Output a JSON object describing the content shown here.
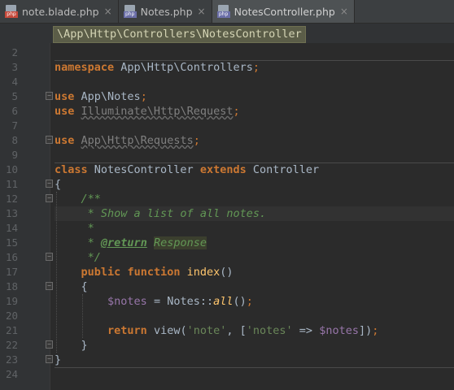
{
  "tabs": [
    {
      "name": "note.blade.php",
      "icon": "blade-file-icon",
      "icon_text": "php",
      "close": "×",
      "active": false
    },
    {
      "name": "Notes.php",
      "icon": "php-file-icon",
      "icon_text": "php",
      "close": "×",
      "active": false
    },
    {
      "name": "NotesController.php",
      "icon": "php-file-icon",
      "icon_text": "php",
      "close": "×",
      "active": true
    }
  ],
  "breadcrumb": "\\App\\Http\\Controllers\\NotesController",
  "editor": {
    "line_numbers": [
      "2",
      "3",
      "4",
      "5",
      "6",
      "7",
      "8",
      "9",
      "10",
      "11",
      "12",
      "13",
      "14",
      "15",
      "16",
      "17",
      "18",
      "19",
      "20",
      "21",
      "22",
      "23",
      "24"
    ],
    "code": {
      "l3_kw": "namespace",
      "l3_ns": " App\\Http\\Controllers",
      "semi": ";",
      "use": "use",
      "l5_path": "App\\Notes",
      "l6_path": "Illuminate\\Http\\Request",
      "l8_path": "App\\Http\\Requests",
      "l10_class": "class",
      "l10_name": " NotesController ",
      "l10_extends": "extends",
      "l10_parent": " Controller",
      "open_brace": "{",
      "close_brace": "}",
      "l12": "/**",
      "l13": " * Show a list of all notes.",
      "star": " *",
      "l15_tag": "@return",
      "l15_type": "Response",
      "l16": " */",
      "l17_public": "public",
      "l17_function": "function",
      "l17_name": " index",
      "l17_parens": "()",
      "l19_var": "$notes",
      "l19_eq": " = Notes::",
      "l19_method": "all",
      "l19_end": "()",
      "l21_return": "return",
      "l21_call": " view(",
      "l21_str1": "'note'",
      "l21_comma": ", [",
      "l21_str2": "'notes'",
      "l21_arrow": " => ",
      "l21_var": "$notes",
      "l21_end": "])"
    }
  }
}
